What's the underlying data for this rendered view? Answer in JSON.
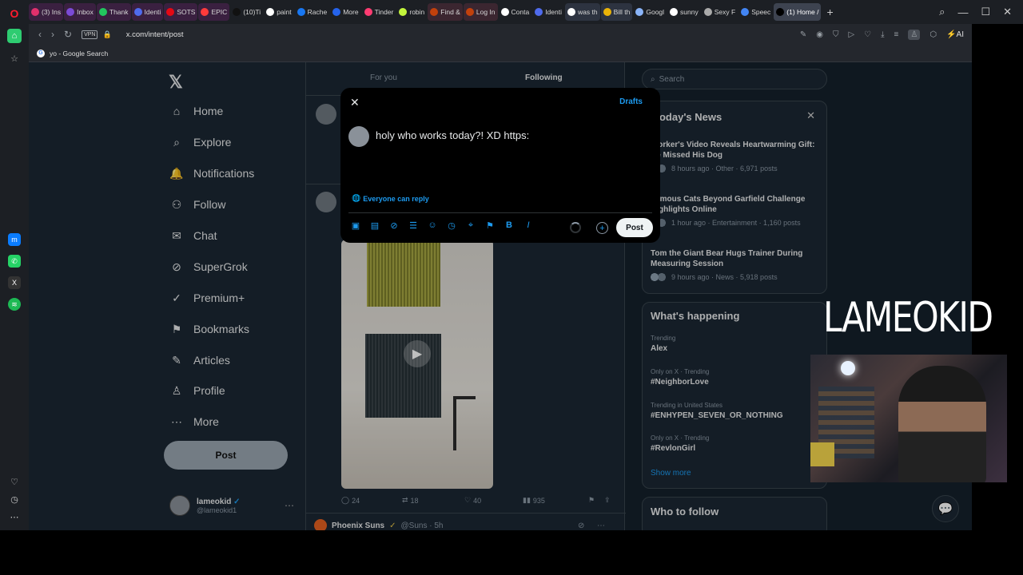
{
  "browser": {
    "tabs": [
      {
        "label": "(3) Ins",
        "color": "#e1306c",
        "group": "g1"
      },
      {
        "label": "Inbox",
        "color": "#7b4bd6",
        "group": "g1"
      },
      {
        "label": "Thank",
        "color": "#22c55e",
        "group": "g1"
      },
      {
        "label": "Identi",
        "color": "#4f6bed",
        "group": "g1"
      },
      {
        "label": "SOTS",
        "color": "#e50914",
        "group": "g1"
      },
      {
        "label": "EPIC",
        "color": "#ff3b3b",
        "group": "g1"
      },
      {
        "label": "(10)Ti",
        "color": "#111111",
        "group": ""
      },
      {
        "label": "paint",
        "color": "#ffffff",
        "group": ""
      },
      {
        "label": "Rache",
        "color": "#1877f2",
        "group": ""
      },
      {
        "label": "More",
        "color": "#2563eb",
        "group": ""
      },
      {
        "label": "Tinder",
        "color": "#fe3c72",
        "group": ""
      },
      {
        "label": "robin",
        "color": "#c3f53c",
        "group": ""
      },
      {
        "label": "Find &",
        "color": "#c2410c",
        "group": "g2"
      },
      {
        "label": "Log In",
        "color": "#c2410c",
        "group": "g2"
      },
      {
        "label": "Conta",
        "color": "#ffffff",
        "group": ""
      },
      {
        "label": "Identi",
        "color": "#4f6bed",
        "group": ""
      },
      {
        "label": "was th",
        "color": "#ffffff",
        "group": "g3"
      },
      {
        "label": "Bill th",
        "color": "#eab308",
        "group": "g3"
      },
      {
        "label": "Googl",
        "color": "#8ab4f8",
        "group": ""
      },
      {
        "label": "sunny",
        "color": "#ffffff",
        "group": ""
      },
      {
        "label": "Sexy F",
        "color": "#aaaaaa",
        "group": ""
      },
      {
        "label": "Speec",
        "color": "#4285f4",
        "group": ""
      },
      {
        "label": "(1) Home /",
        "color": "#000000",
        "group": "active"
      }
    ],
    "new_tab": "+",
    "url": "x.com/intent/post",
    "vpn": "VPN",
    "bookmark": "yo - Google Search",
    "ai_label": "AI"
  },
  "nav": {
    "logo": "𝕏",
    "items": [
      {
        "label": "Home",
        "icon": "⌂",
        "name": "home"
      },
      {
        "label": "Explore",
        "icon": "⌕",
        "name": "explore"
      },
      {
        "label": "Notifications",
        "icon": "🔔",
        "name": "notifications"
      },
      {
        "label": "Follow",
        "icon": "⚇",
        "name": "follow"
      },
      {
        "label": "Chat",
        "icon": "✉",
        "name": "chat"
      },
      {
        "label": "SuperGrok",
        "icon": "⊘",
        "name": "supergrok"
      },
      {
        "label": "Premium+",
        "icon": "✓",
        "name": "premium"
      },
      {
        "label": "Bookmarks",
        "icon": "⚑",
        "name": "bookmarks"
      },
      {
        "label": "Articles",
        "icon": "✎",
        "name": "articles"
      },
      {
        "label": "Profile",
        "icon": "♙",
        "name": "profile"
      },
      {
        "label": "More",
        "icon": "⋯",
        "name": "more"
      }
    ],
    "post_label": "Post",
    "user_name": "lameokid",
    "user_handle": "@lameokid1",
    "verified": "✓"
  },
  "timeline": {
    "tab_foryou": "For you",
    "tab_following": "Following",
    "stats": {
      "replies": "24",
      "reposts": "18",
      "likes": "40",
      "views": "935"
    },
    "next_author": "Phoenix Suns",
    "next_handle": "@Suns · 5h"
  },
  "right": {
    "search_placeholder": "Search",
    "news_title": "Today's News",
    "news": [
      {
        "headline": "Worker's Video Reveals Heartwarming Gift: He Missed His Dog",
        "meta": "8 hours ago · Other · 6,971 posts"
      },
      {
        "headline": "Famous Cats Beyond Garfield Challenge Highlights Online",
        "meta": "1 hour ago · Entertainment · 1,160 posts"
      },
      {
        "headline": "Tom the Giant Bear Hugs Trainer During Measuring Session",
        "meta": "9 hours ago · News · 5,918 posts"
      }
    ],
    "happening_title": "What's happening",
    "trends": [
      {
        "context": "Trending",
        "name": "Alex"
      },
      {
        "context": "Only on X · Trending",
        "name": "#NeighborLove"
      },
      {
        "context": "Trending in United States",
        "name": "#ENHYPEN_SEVEN_OR_NOTHING"
      },
      {
        "context": "Only on X · Trending",
        "name": "#RevlonGirl"
      }
    ],
    "show_more": "Show more",
    "who_to_follow": "Who to follow"
  },
  "compose": {
    "drafts": "Drafts",
    "text": "holy who works today?! XD https:",
    "reply_setting": "Everyone can reply",
    "post_label": "Post"
  },
  "overlay": {
    "streamer_name": "LAMEOKID"
  }
}
